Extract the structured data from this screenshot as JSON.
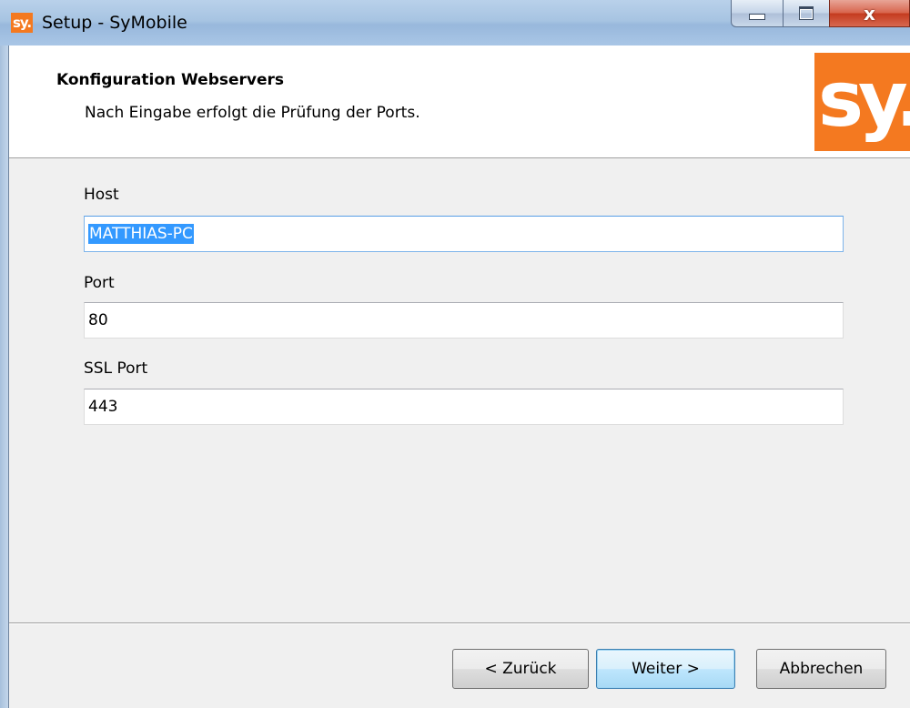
{
  "window": {
    "title": "Setup - SyMobile",
    "logo_text": "sy.",
    "close_glyph": "x"
  },
  "header": {
    "title": "Konfiguration Webservers",
    "subtitle": "Nach Eingabe erfolgt die Prüfung der Ports.",
    "logo_text": "sy."
  },
  "form": {
    "host": {
      "label": "Host",
      "value": "MATTHIAS-PC",
      "selected": true
    },
    "port": {
      "label": "Port",
      "value": "80"
    },
    "ssl_port": {
      "label": "SSL Port",
      "value": "443"
    }
  },
  "buttons": {
    "back": "< Zurück",
    "next": "Weiter >",
    "cancel": "Abbrechen"
  },
  "colors": {
    "brand": "#f47920",
    "selection": "#3399ff",
    "close_button": "#c43a1e"
  },
  "icons": {
    "minimize": "minimize-icon",
    "maximize": "maximize-icon",
    "close": "close-icon"
  }
}
